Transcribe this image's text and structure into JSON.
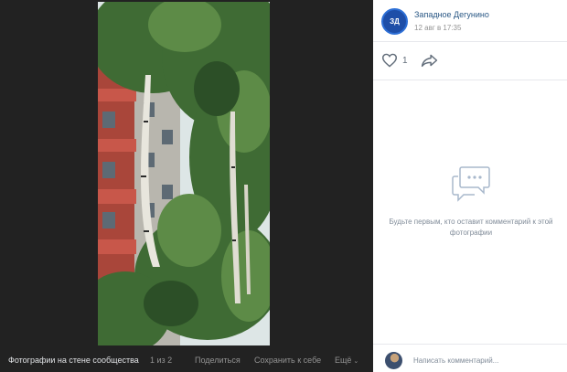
{
  "viewer": {
    "album_title": "Фотографии на стене сообщества",
    "counter": "1 из 2",
    "share_label": "Поделиться",
    "save_label": "Сохранить к себе",
    "more_label": "Ещё"
  },
  "post": {
    "avatar_text": "ЗД",
    "group_name": "Западное Дегунино",
    "date": "12 авг в 17:35",
    "likes": "1"
  },
  "comments": {
    "empty_text": "Будьте первым, кто оставит комментарий к этой фотографии",
    "input_placeholder": "Написать комментарий..."
  },
  "colors": {
    "viewer_bg": "#222222",
    "link": "#2a5885",
    "muted": "#818c99",
    "avatar_bg": "#1e4ea8"
  },
  "icons": {
    "like": "heart-icon",
    "share": "share-arrow-icon",
    "empty": "comment-bubble-icon",
    "more": "chevron-down-icon"
  }
}
